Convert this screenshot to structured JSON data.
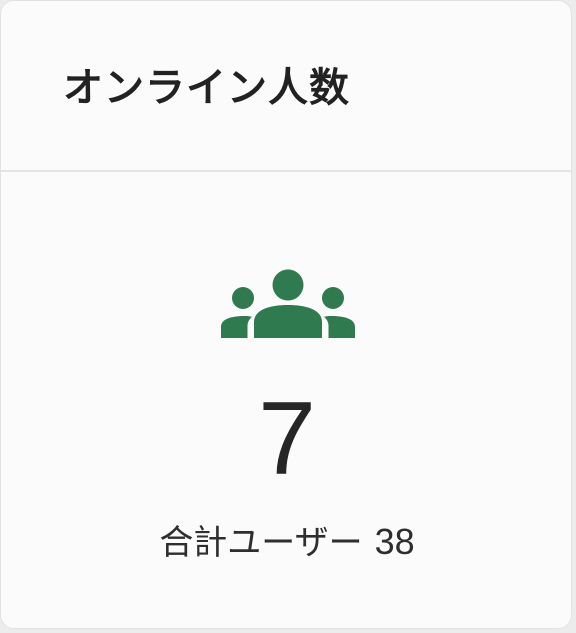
{
  "card": {
    "title": "オンライン人数",
    "icon": "users-group-icon",
    "icon_color": "#2f7a4f",
    "online_count": "7",
    "total_label": "合計ユーザー",
    "total_value": "38"
  }
}
